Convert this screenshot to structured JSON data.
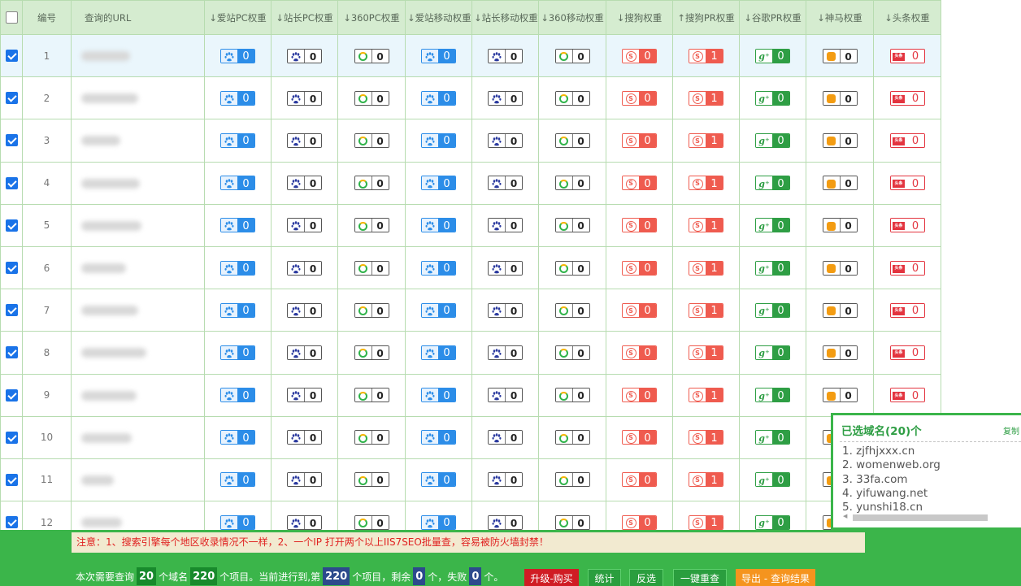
{
  "table": {
    "columns": [
      "编号",
      "查询的URL",
      "↓爱站PC权重",
      "↓站长PC权重",
      "↓360PC权重",
      "↓爱站移动权重",
      "↓站长移动权重",
      "↓360移动权重",
      "↓搜狗权重",
      "↑搜狗PR权重",
      "↓谷歌PR权重",
      "↓神马权重",
      "↓头条权重"
    ],
    "badge_types": [
      "aizhan",
      "chinaz",
      "360",
      "aizhan",
      "chinaz",
      "360",
      "sogou",
      "sogou",
      "google",
      "shenma",
      "toutiao"
    ],
    "rows": [
      {
        "num": "1",
        "checked": true,
        "weights": [
          "0",
          "0",
          "0",
          "0",
          "0",
          "0",
          "0",
          "1",
          "0",
          "0",
          "0"
        ]
      },
      {
        "num": "2",
        "checked": true,
        "weights": [
          "0",
          "0",
          "0",
          "0",
          "0",
          "0",
          "0",
          "1",
          "0",
          "0",
          "0"
        ]
      },
      {
        "num": "3",
        "checked": true,
        "weights": [
          "0",
          "0",
          "0",
          "0",
          "0",
          "0",
          "0",
          "1",
          "0",
          "0",
          "0"
        ]
      },
      {
        "num": "4",
        "checked": true,
        "weights": [
          "0",
          "0",
          "0",
          "0",
          "0",
          "0",
          "0",
          "1",
          "0",
          "0",
          "0"
        ]
      },
      {
        "num": "5",
        "checked": true,
        "weights": [
          "0",
          "0",
          "0",
          "0",
          "0",
          "0",
          "0",
          "1",
          "0",
          "0",
          "0"
        ]
      },
      {
        "num": "6",
        "checked": true,
        "weights": [
          "0",
          "0",
          "0",
          "0",
          "0",
          "0",
          "0",
          "1",
          "0",
          "0",
          "0"
        ]
      },
      {
        "num": "7",
        "checked": true,
        "weights": [
          "0",
          "0",
          "0",
          "0",
          "0",
          "0",
          "0",
          "1",
          "0",
          "0",
          "0"
        ]
      },
      {
        "num": "8",
        "checked": true,
        "weights": [
          "0",
          "0",
          "0",
          "0",
          "0",
          "0",
          "0",
          "1",
          "0",
          "0",
          "0"
        ]
      },
      {
        "num": "9",
        "checked": true,
        "weights": [
          "0",
          "0",
          "0",
          "0",
          "0",
          "0",
          "0",
          "1",
          "0",
          "0",
          "0"
        ]
      },
      {
        "num": "10",
        "checked": true,
        "weights": [
          "0",
          "0",
          "0",
          "0",
          "0",
          "0",
          "0",
          "1",
          "0",
          "0",
          "0"
        ]
      },
      {
        "num": "11",
        "checked": true,
        "weights": [
          "0",
          "0",
          "0",
          "0",
          "0",
          "0",
          "0",
          "1",
          "0",
          "0",
          "0"
        ]
      },
      {
        "num": "12",
        "checked": true,
        "weights": [
          "0",
          "0",
          "0",
          "0",
          "0",
          "0",
          "0",
          "1",
          "0",
          "0",
          "0"
        ]
      }
    ]
  },
  "icons": {
    "aizhan": "paw-icon",
    "chinaz": "paw-icon",
    "360": "360-logo-icon",
    "sogou": "sogou-logo-icon",
    "sogou_glyph": "S",
    "google": "google-plus-icon",
    "google_glyph": "g⁺",
    "shenma": "shenma-horse-icon",
    "toutiao": "toutiao-logo-icon",
    "toutiao_glyph": "头条"
  },
  "notice": "注意：1、搜索引擎每个地区收录情况不一样，2、一个IP 打开两个以上IIS7SEO批量查，容易被防火墙封禁！",
  "status": {
    "prefix": "本次需要查询",
    "domain_count": "20",
    "domain_unit": "个域名",
    "item_count": "220",
    "item_unit": "个项目。当前进行到,第",
    "current_item": "220",
    "remaining_label": "个项目，剩余",
    "remaining": "0",
    "failed_label": "个，失败",
    "failed": "0",
    "suffix": "个。"
  },
  "buttons": {
    "upgrade": "升级-购买",
    "stats": "统计",
    "invert": "反选",
    "recheck": "一键重查",
    "export": "导出 - 查询结果"
  },
  "selected_panel": {
    "title": "已选域名(20)个",
    "copy_label": "复制",
    "domains": [
      "1. zjfhjxxx.cn",
      "2. womenweb.org",
      "3. 33fa.com",
      "4. yifuwang.net",
      "5. yunshi18.cn"
    ]
  },
  "colors": {
    "header_bg": "#d5ecd0",
    "bottom_bar": "#3bb54a",
    "aizhan_blue": "#2c8de8",
    "sogou_red": "#ef5b4f",
    "google_green": "#2e9e44",
    "toutiao_red": "#e3343f",
    "notice_red": "#e02020"
  }
}
